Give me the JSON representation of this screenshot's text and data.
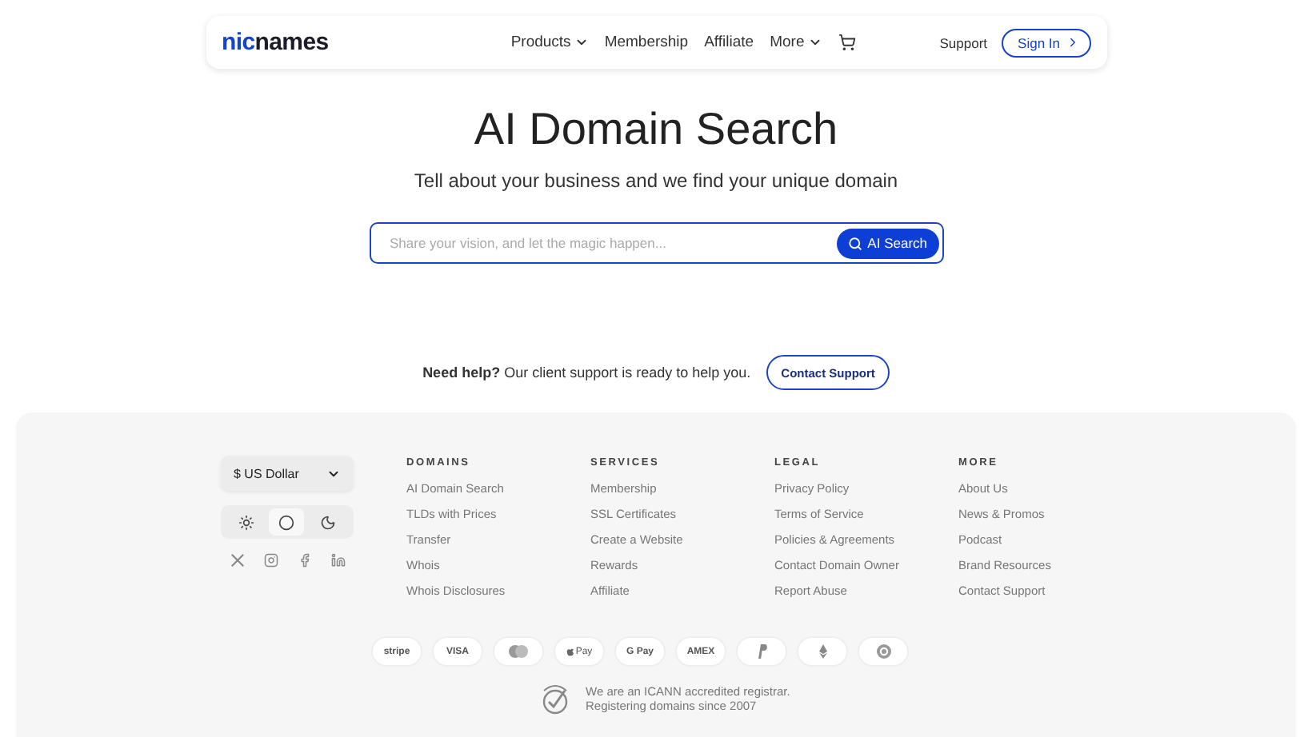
{
  "header": {
    "logo": {
      "part_1": "nic",
      "part_2": "names"
    },
    "nav": [
      {
        "label": "Products",
        "dropdown": true
      },
      {
        "label": "Membership",
        "dropdown": false
      },
      {
        "label": "Affiliate",
        "dropdown": false
      },
      {
        "label": "More",
        "dropdown": true
      }
    ],
    "support": "Support",
    "sign_in": "Sign In"
  },
  "hero": {
    "title": "AI Domain Search",
    "subtitle": "Tell about your business and we find your unique domain",
    "search": {
      "placeholder": "Share your vision, and let the magic happen...",
      "button": "AI Search"
    }
  },
  "help": {
    "text": "**Need help?** Our client support is ready to help you.",
    "button": "Contact Support"
  },
  "footer": {
    "currency": "$ US Dollar",
    "themes": [
      {
        "kind": "light",
        "selected": false
      },
      {
        "kind": "system",
        "selected": true
      },
      {
        "kind": "dark",
        "selected": false
      }
    ],
    "socials": [
      {
        "kind": "x"
      },
      {
        "kind": "instagram"
      },
      {
        "kind": "facebook"
      },
      {
        "kind": "linkedin"
      }
    ],
    "columns": [
      {
        "title": "DOMAINS",
        "links": [
          "AI Domain Search",
          "TLDs with Prices",
          "Transfer",
          "Whois",
          "Whois Disclosures"
        ]
      },
      {
        "title": "SERVICES",
        "links": [
          "Membership",
          "SSL Certificates",
          "Create a Website",
          "Rewards",
          "Affiliate"
        ]
      },
      {
        "title": "LEGAL",
        "links": [
          "Privacy Policy",
          "Terms of Service",
          "Policies & Agreements",
          "Contact Domain Owner",
          "Report Abuse"
        ]
      },
      {
        "title": "MORE",
        "links": [
          "About Us",
          "News & Promos",
          "Podcast",
          "Brand Resources",
          "Contact Support"
        ]
      }
    ],
    "payments": [
      {
        "kind": "text",
        "label": "stripe"
      },
      {
        "kind": "text",
        "label": "VISA"
      },
      {
        "kind": "mastercard"
      },
      {
        "kind": "applepay",
        "label": "Pay"
      },
      {
        "kind": "text",
        "label": "G Pay"
      },
      {
        "kind": "text",
        "label": "AMEX"
      },
      {
        "kind": "paypal"
      },
      {
        "kind": "ethereum"
      },
      {
        "kind": "bitcoin"
      }
    ],
    "icann": [
      "We are an ICANN accredited registrar.",
      "Registering domains since 2007"
    ]
  }
}
